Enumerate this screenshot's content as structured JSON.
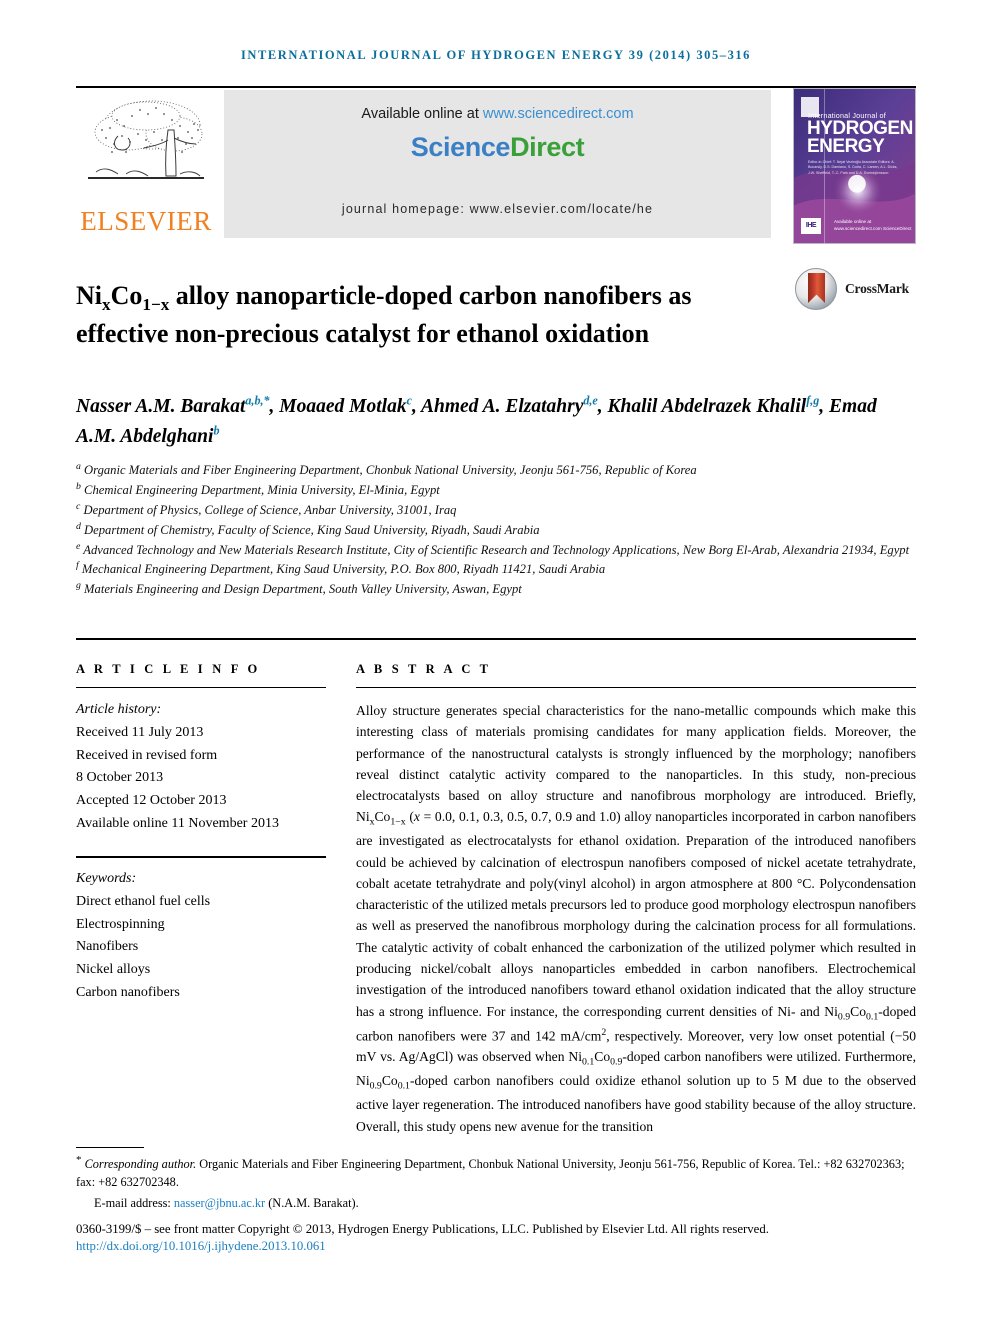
{
  "running_head": "INTERNATIONAL JOURNAL OF HYDROGEN ENERGY 39 (2014) 305–316",
  "masthead": {
    "publisher_name": "ELSEVIER",
    "publisher_logo_icon": "elsevier-tree-icon",
    "available_prefix": "Available online at ",
    "available_url": "www.sciencedirect.com",
    "sciencedirect_part1": "Science",
    "sciencedirect_part2": "Direct",
    "journal_homepage": "journal homepage: www.elsevier.com/locate/he",
    "cover": {
      "line_small": "International Journal of",
      "line_big_1": "HYDROGEN",
      "line_big_2": "ENERGY",
      "editors": "Editor-in-Chief: T. Nejat Veziroğlu\nAssociate Editors: A. Bocarsly, D.S. Damiano, S. Dutta, C. Larsen, A.L. Dicks, J.W. Sheffield, T.-C. Park and D.A. Sveinbjörnsson",
      "sciencedirect_mark": "Available online at www.sciencedirect.com\nScienceDirect",
      "ihe_mark": "IHE"
    },
    "colors": {
      "running_head": "#0b6f9c",
      "elsevier_orange": "#f08020",
      "science_blue": "#3b7fc4",
      "direct_green": "#3aa03a",
      "link_blue": "#3a8fd0",
      "panel_gray": "#e6e6e6"
    }
  },
  "article": {
    "title_html": "Ni<sub>x</sub>Co<sub>1−x</sub> alloy nanoparticle-doped carbon nanofibers as effective non-precious catalyst for ethanol oxidation",
    "crossmark_label": "CrossMark",
    "authors_html": "Nasser A.M. Barakat<sup>a,b,*</sup>, Moaaed Motlak<sup>c</sup>, Ahmed A. Elzatahry<sup>d,e</sup>, Khalil Abdelrazek Khalil<sup>f,g</sup>, Emad A.M. Abdelghani<sup>b</sup>",
    "affiliations": [
      {
        "marker": "a",
        "text": "Organic Materials and Fiber Engineering Department, Chonbuk National University, Jeonju 561-756, Republic of Korea"
      },
      {
        "marker": "b",
        "text": "Chemical Engineering Department, Minia University, El-Minia, Egypt"
      },
      {
        "marker": "c",
        "text": "Department of Physics, College of Science, Anbar University, 31001, Iraq"
      },
      {
        "marker": "d",
        "text": "Department of Chemistry, Faculty of Science, King Saud University, Riyadh, Saudi Arabia"
      },
      {
        "marker": "e",
        "text": "Advanced Technology and New Materials Research Institute, City of Scientific Research and Technology Applications, New Borg El-Arab, Alexandria 21934, Egypt"
      },
      {
        "marker": "f",
        "text": "Mechanical Engineering Department, King Saud University, P.O. Box 800, Riyadh 11421, Saudi Arabia"
      },
      {
        "marker": "g",
        "text": "Materials Engineering and Design Department, South Valley University, Aswan, Egypt"
      }
    ]
  },
  "article_info": {
    "heading": "A R T I C L E  I N F O",
    "history_label": "Article history:",
    "history": [
      "Received 11 July 2013",
      "Received in revised form",
      "8 October 2013",
      "Accepted 12 October 2013",
      "Available online 11 November 2013"
    ],
    "keywords_label": "Keywords:",
    "keywords": [
      "Direct ethanol fuel cells",
      "Electrospinning",
      "Nanofibers",
      "Nickel alloys",
      "Carbon nanofibers"
    ]
  },
  "abstract": {
    "heading": "A B S T R A C T",
    "body_html": "Alloy structure generates special characteristics for the nano-metallic compounds which make this interesting class of materials promising candidates for many application fields. Moreover, the performance of the nanostructural catalysts is strongly influenced by the morphology; nanofibers reveal distinct catalytic activity compared to the nanoparticles. In this study, non-precious electrocatalysts based on alloy structure and nanofibrous morphology are introduced. Briefly, Ni<sub>x</sub>Co<sub>1−x</sub> (<i>x</i> = 0.0, 0.1, 0.3, 0.5, 0.7, 0.9 and 1.0) alloy nanoparticles incorporated in carbon nanofibers are investigated as electrocatalysts for ethanol oxidation. Preparation of the introduced nanofibers could be achieved by calcination of electrospun nanofibers composed of nickel acetate tetrahydrate, cobalt acetate tetrahydrate and poly(vinyl alcohol) in argon atmosphere at 800 °C. Polycondensation characteristic of the utilized metals precursors led to produce good morphology electrospun nanofibers as well as preserved the nanofibrous morphology during the calcination process for all formulations. The catalytic activity of cobalt enhanced the carbonization of the utilized polymer which resulted in producing nickel/cobalt alloys nanoparticles embedded in carbon nanofibers. Electrochemical investigation of the introduced nanofibers toward ethanol oxidation indicated that the alloy structure has a strong influence. For instance, the corresponding current densities of Ni- and Ni<sub>0.9</sub>Co<sub>0.1</sub>-doped carbon nanofibers were 37 and 142 mA/cm<sup>2</sup>, respectively. Moreover, very low onset potential (−50 mV vs. Ag/AgCl) was observed when Ni<sub>0.1</sub>Co<sub>0.9</sub>-doped carbon nanofibers were utilized. Furthermore, Ni<sub>0.9</sub>Co<sub>0.1</sub>-doped carbon nanofibers could oxidize ethanol solution up to 5 M due to the observed active layer regeneration. The introduced nanofibers have good stability because of the alloy structure. Overall, this study opens new avenue for the transition"
  },
  "footnote": {
    "marker": "*",
    "corresponding_label": "Corresponding author.",
    "corresponding_text": " Organic Materials and Fiber Engineering Department, Chonbuk National University, Jeonju 561-756, Republic of Korea. Tel.: +82 632702363; fax: +82 632702348.",
    "email_label": "E-mail address: ",
    "email": "nasser@jbnu.ac.kr",
    "email_suffix": " (N.A.M. Barakat)."
  },
  "copyright": {
    "text": "0360-3199/$ – see front matter Copyright © 2013, Hydrogen Energy Publications, LLC. Published by Elsevier Ltd. All rights reserved.",
    "doi": "http://dx.doi.org/10.1016/j.ijhydene.2013.10.061"
  }
}
